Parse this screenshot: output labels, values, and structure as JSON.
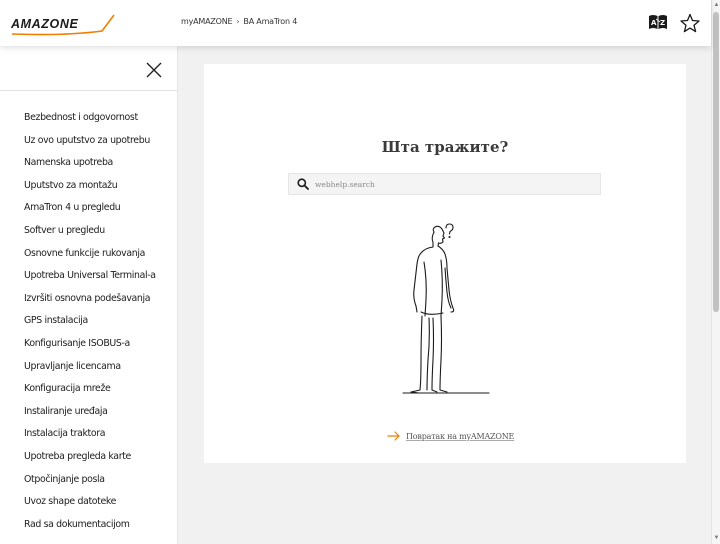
{
  "header": {
    "logo_text": "AMAZONE",
    "breadcrumb": [
      "myAMAZONE",
      "BA AmaTron 4"
    ],
    "breadcrumb_separator": "›",
    "icons": {
      "language": "language-dictionary-icon",
      "favorite": "star-icon"
    }
  },
  "sidebar": {
    "close_icon": "close-icon",
    "items": [
      {
        "label": "Bezbednost i odgovornost"
      },
      {
        "label": "Uz ovo uputstvo za upotrebu"
      },
      {
        "label": "Namenska upotreba"
      },
      {
        "label": "Uputstvo za montažu"
      },
      {
        "label": "AmaTron 4 u pregledu"
      },
      {
        "label": "Softver u pregledu"
      },
      {
        "label": "Osnovne funkcije rukovanja"
      },
      {
        "label": "Upotreba Universal Terminal-a"
      },
      {
        "label": "Izvršiti osnovna podešavanja"
      },
      {
        "label": "GPS instalacija"
      },
      {
        "label": "Konfigurisanje ISOBUS-a"
      },
      {
        "label": "Upravljanje licencama"
      },
      {
        "label": "Konfiguracija mreže"
      },
      {
        "label": "Instaliranje uređaja"
      },
      {
        "label": "Instalacija traktora"
      },
      {
        "label": "Upotreba pregleda karte"
      },
      {
        "label": "Otpočinjanje posla"
      },
      {
        "label": "Uvoz shape datoteke"
      },
      {
        "label": "Rad sa dokumentacijom"
      }
    ]
  },
  "main": {
    "title": "Шта тражите?",
    "search": {
      "placeholder": "webhelp.search",
      "value": ""
    },
    "back_link": "Повратак на myAMAZONE"
  },
  "colors": {
    "accent_orange": "#f07d00",
    "header_bg": "#ffffff",
    "page_bg": "#f1f1f1"
  }
}
